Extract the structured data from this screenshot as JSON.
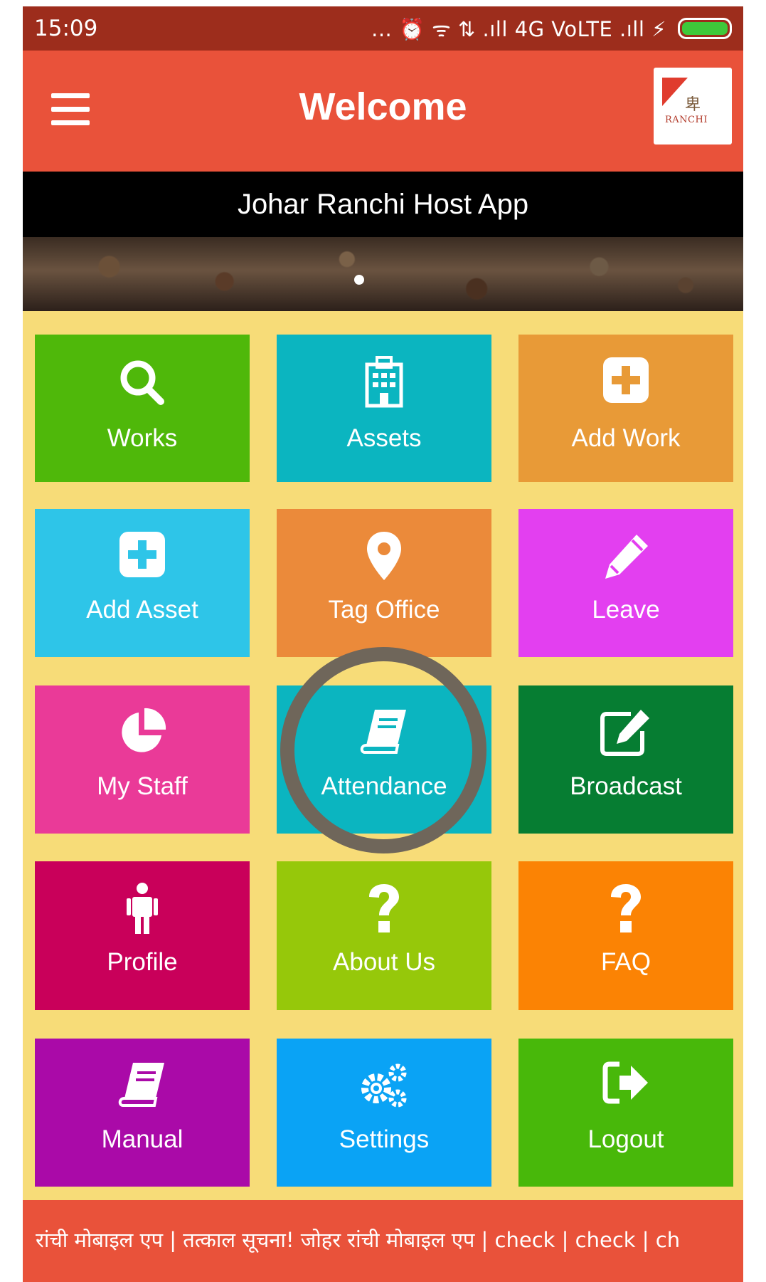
{
  "status_bar": {
    "time": "15:09",
    "indicators": "... ⏰ ᯤ ⇅ .ıll 4G VoLTE .ıll ⚡"
  },
  "app_bar": {
    "title": "Welcome",
    "menu_icon": "hamburger-menu-icon",
    "logo_text": "RANCHI"
  },
  "banner": {
    "title": "Johar Ranchi Host App"
  },
  "slider": {
    "active_index": 0
  },
  "tiles": [
    {
      "label": "Works",
      "icon": "search-icon",
      "color": "#4fb80a"
    },
    {
      "label": "Assets",
      "icon": "hospital-building-icon",
      "color": "#0bb5c0"
    },
    {
      "label": "Add Work",
      "icon": "plus-square-icon",
      "color": "#e89a37"
    },
    {
      "label": "Add Asset",
      "icon": "plus-square-icon",
      "color": "#2ec5e8"
    },
    {
      "label": "Tag Office",
      "icon": "map-marker-icon",
      "color": "#eb8a3a"
    },
    {
      "label": "Leave",
      "icon": "pencil-icon",
      "color": "#e33ff0"
    },
    {
      "label": "My Staff",
      "icon": "pie-chart-icon",
      "color": "#ea3a98"
    },
    {
      "label": "Attendance",
      "icon": "book-icon",
      "color": "#0bb5c0"
    },
    {
      "label": "Broadcast",
      "icon": "edit-square-icon",
      "color": "#067d32"
    },
    {
      "label": "Profile",
      "icon": "person-icon",
      "color": "#c9005a"
    },
    {
      "label": "About Us",
      "icon": "question-icon",
      "color": "#96c80a"
    },
    {
      "label": "FAQ",
      "icon": "question-icon",
      "color": "#fb8304"
    },
    {
      "label": "Manual",
      "icon": "book-icon",
      "color": "#aa0aa8"
    },
    {
      "label": "Settings",
      "icon": "gears-icon",
      "color": "#0aa3f5"
    },
    {
      "label": "Logout",
      "icon": "sign-out-icon",
      "color": "#48b80a"
    }
  ],
  "footer": {
    "ticker": "रांची मोबाइल एप | तत्काल सूचना! जोहर रांची मोबाइल एप | check | check | ch"
  }
}
